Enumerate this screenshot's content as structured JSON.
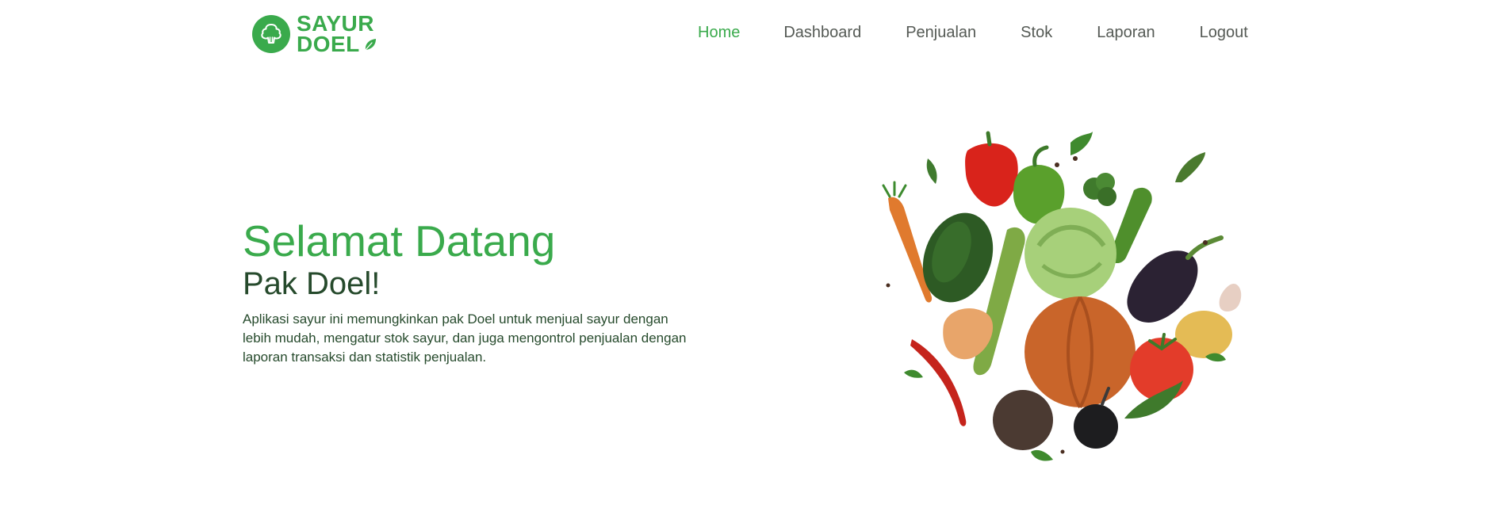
{
  "brand": {
    "line1": "SAYUR",
    "line2": "DOEL",
    "color": "#3aaa4c",
    "icon": "broccoli-icon"
  },
  "nav": {
    "items": [
      {
        "label": "Home",
        "active": true
      },
      {
        "label": "Dashboard",
        "active": false
      },
      {
        "label": "Penjualan",
        "active": false
      },
      {
        "label": "Stok",
        "active": false
      },
      {
        "label": "Laporan",
        "active": false
      },
      {
        "label": "Logout",
        "active": false
      }
    ],
    "active_color": "#3aaa4c",
    "text_color": "#555a55"
  },
  "hero": {
    "title": "Selamat Datang",
    "subtitle": "Pak Doel!",
    "description": "Aplikasi sayur ini memungkinkan pak Doel untuk menjual sayur dengan lebih mudah, mengatur stok sayur, dan juga mengontrol penjualan dengan laporan transaksi dan statistik penjualan.",
    "illustration": "vegetables-image"
  }
}
